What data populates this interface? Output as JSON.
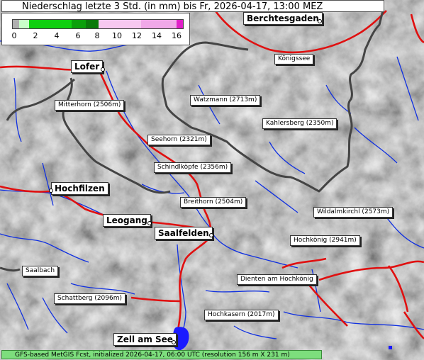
{
  "title": "Niederschlag letzte 3 Std. (in mm) bis Fr, 2026-04-17, 13:00 MEZ",
  "legend": {
    "ticks": [
      "0",
      "2",
      "4",
      "6",
      "8",
      "10",
      "12",
      "14",
      "16"
    ],
    "colors": [
      "#b0b0b0",
      "#c8ffc8",
      "#10d010",
      "#0aa00a",
      "#0a7a0a",
      "#f7c8f0",
      "#f0a8e8",
      "#e878d8",
      "#e020c8"
    ]
  },
  "places": {
    "berchtesgaden": "Berchtesgaden",
    "lofer": "Lofer",
    "hochfilzen": "Hochfilzen",
    "leogang": "Leogang",
    "saalfelden": "Saalfelden",
    "zell_am_see": "Zell am See",
    "koenigssee": "Königssee",
    "mitterhorn": "Mitterhorn (2506m)",
    "watzmann": "Watzmann (2713m)",
    "kahlersberg": "Kahlersberg (2350m)",
    "seehorn": "Seehorn (2321m)",
    "schindlkoepfe": "Schindlköpfe (2356m)",
    "breithorn": "Breithorn (2504m)",
    "wildalmkirchl": "Wildalmkirchl (2573m)",
    "hochkoenig": "Hochkönig (2941m)",
    "saalbach": "Saalbach",
    "dienten": "Dienten am Hochkönig",
    "schattberg": "Schattberg (2096m)",
    "hochkasern": "Hochkasern (2017m)"
  },
  "footer": "GFS-based MetGIS Fcst, initialized 2026-04-17, 06:00 UTC  (resolution 156 m X 231 m)",
  "colors": {
    "roads": "#e01010",
    "rivers": "#1030e0",
    "borders": "#444444",
    "lake": "#1a1aff",
    "footer_bg": "#7dde7d"
  }
}
